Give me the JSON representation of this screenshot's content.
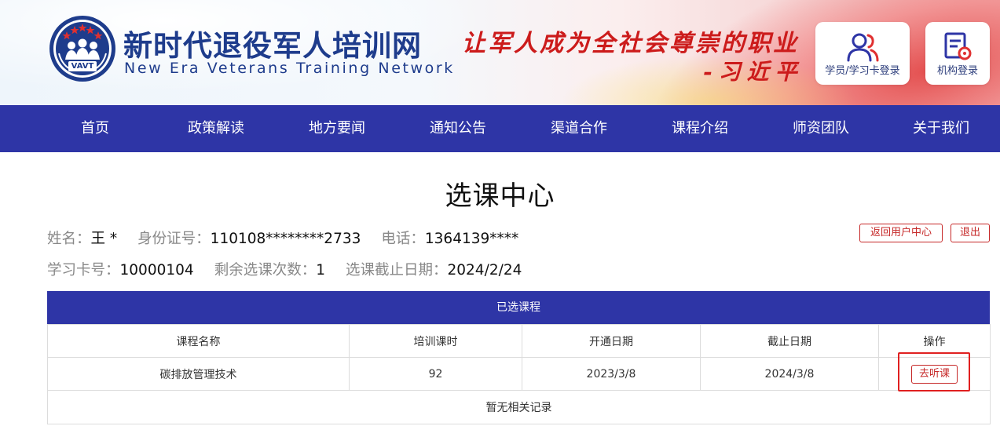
{
  "header": {
    "title": "新时代退役军人培训网",
    "subtitle": "New Era Veterans Training Network",
    "logo_text": "VAVT",
    "slogan": "让军人成为全社会尊崇的职业",
    "slogan_author": "-习近平",
    "login_student": "学员/学习卡登录",
    "login_org": "机构登录"
  },
  "nav": {
    "items": [
      "首页",
      "政策解读",
      "地方要闻",
      "通知公告",
      "渠道合作",
      "课程介绍",
      "师资团队",
      "关于我们"
    ]
  },
  "page": {
    "title": "选课中心"
  },
  "user_info": {
    "name_label": "姓名：",
    "name": "王 *",
    "id_label": "身份证号：",
    "id_number": "110108********2733",
    "phone_label": "电话：",
    "phone": "1364139****",
    "card_label": "学习卡号：",
    "card_number": "10000104",
    "remaining_label": "剩余选课次数：",
    "remaining": "1",
    "deadline_label": "选课截止日期：",
    "deadline": "2024/2/24"
  },
  "actions": {
    "back_label": "返回用户中心",
    "exit_label": "退出"
  },
  "table": {
    "caption": "已选课程",
    "columns": [
      "课程名称",
      "培训课时",
      "开通日期",
      "截止日期",
      "操作"
    ],
    "rows": [
      {
        "name": "碳排放管理技术",
        "hours": "92",
        "start": "2023/3/8",
        "end": "2024/3/8",
        "action": "去听课"
      }
    ],
    "empty_text": "暂无相关记录"
  },
  "colors": {
    "nav_bg": "#2e35a6",
    "brand_blue": "#1e3c8c",
    "accent_red": "#c62828",
    "highlight": "#e02020"
  },
  "icons": {
    "student_login": "users-icon",
    "org_login": "document-gear-icon",
    "logo": "vavt-emblem-icon"
  }
}
